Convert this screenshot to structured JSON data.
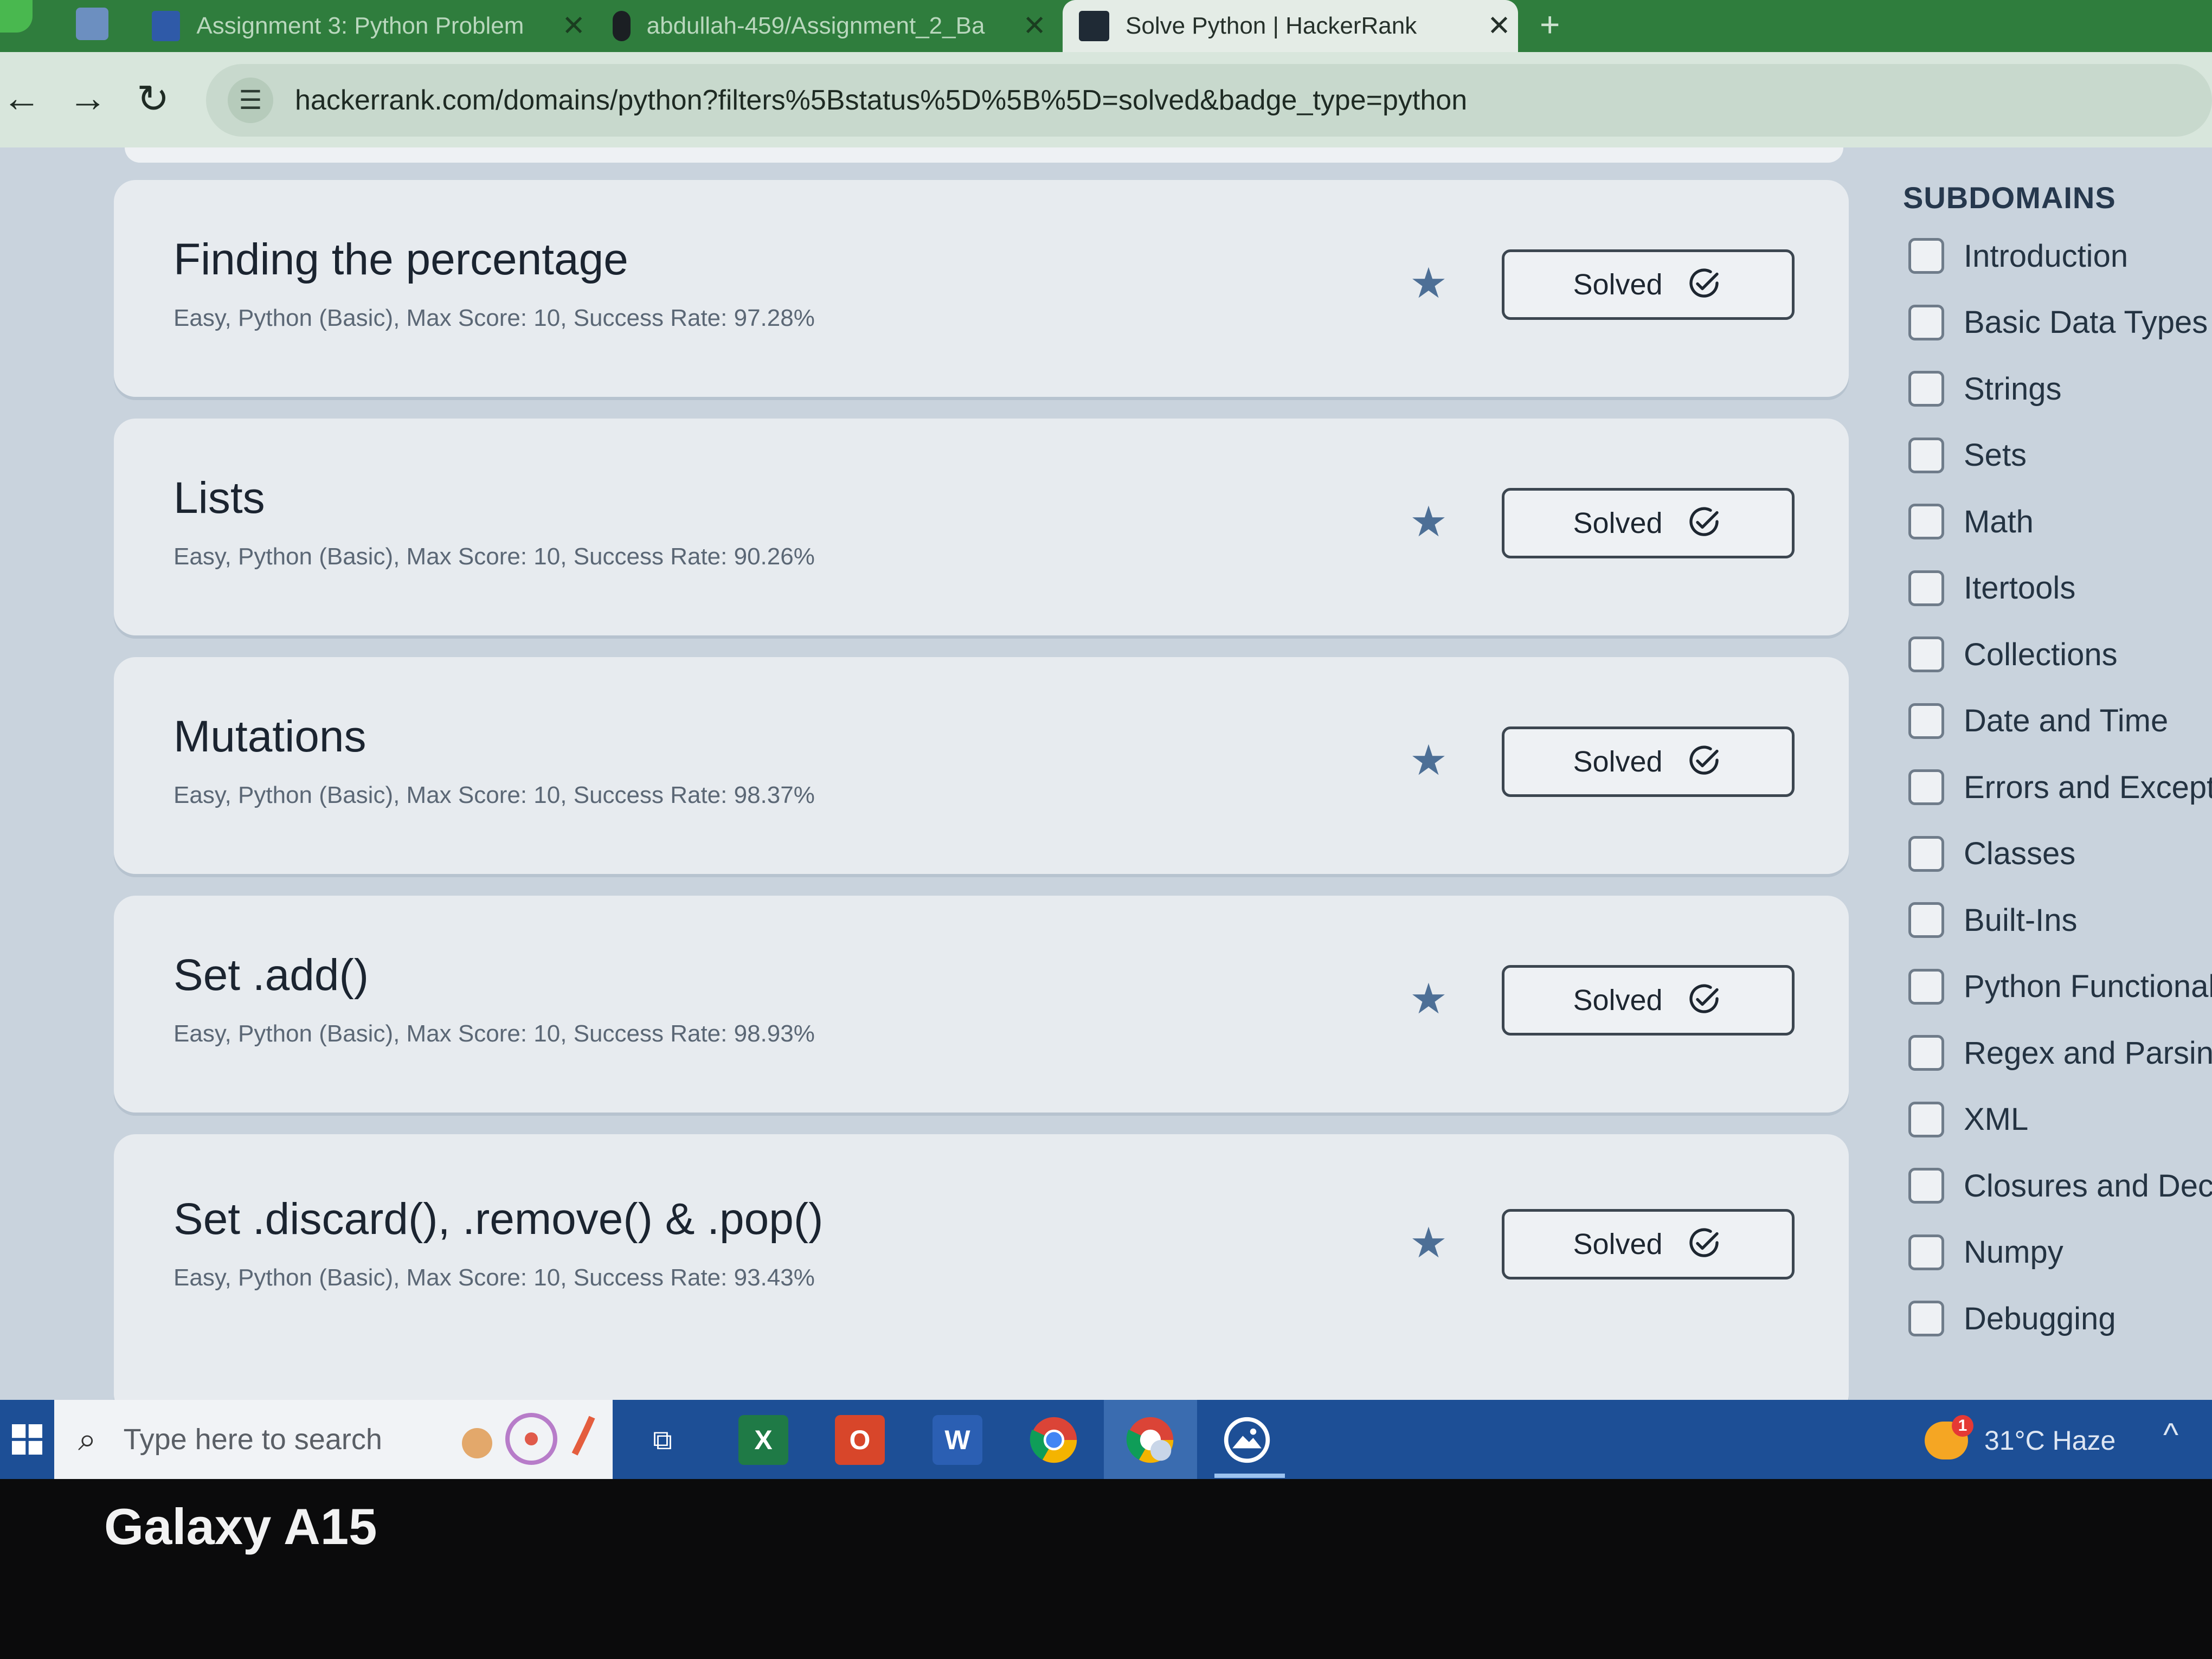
{
  "browser": {
    "tabs": [
      {
        "label": "Assignment 3: Python Problem",
        "active": false
      },
      {
        "label": "abdullah-459/Assignment_2_Ba",
        "active": false
      },
      {
        "label": "Solve Python | HackerRank",
        "active": true
      }
    ],
    "new_tab_label": "+",
    "url": "hackerrank.com/domains/python?filters%5Bstatus%5D%5B%5D=solved&badge_type=python"
  },
  "challenges": [
    {
      "title": "Finding the percentage",
      "meta": "Easy, Python (Basic), Max Score: 10, Success Rate: 97.28%",
      "status": "Solved"
    },
    {
      "title": "Lists",
      "meta": "Easy, Python (Basic), Max Score: 10, Success Rate: 90.26%",
      "status": "Solved"
    },
    {
      "title": "Mutations",
      "meta": "Easy, Python (Basic), Max Score: 10, Success Rate: 98.37%",
      "status": "Solved"
    },
    {
      "title": "Set .add()",
      "meta": "Easy, Python (Basic), Max Score: 10, Success Rate: 98.93%",
      "status": "Solved"
    },
    {
      "title": "Set .discard(), .remove() & .pop()",
      "meta": "Easy, Python (Basic), Max Score: 10, Success Rate: 93.43%",
      "status": "Solved"
    }
  ],
  "sidebar": {
    "title": "SUBDOMAINS",
    "items": [
      "Introduction",
      "Basic Data Types",
      "Strings",
      "Sets",
      "Math",
      "Itertools",
      "Collections",
      "Date and Time",
      "Errors and Excepti",
      "Classes",
      "Built-Ins",
      "Python Functional",
      "Regex and Parsing",
      "XML",
      "Closures and Deco",
      "Numpy",
      "Debugging"
    ]
  },
  "taskbar": {
    "search_placeholder": "Type here to search",
    "weather": "31°C  Haze",
    "weather_alert_count": "1",
    "apps": [
      "task-view",
      "excel",
      "office",
      "word",
      "chrome",
      "chrome-profile",
      "photos"
    ]
  },
  "device": {
    "watermark": "Galaxy A15"
  },
  "colors": {
    "accent": "#2f7d3d",
    "taskbar": "#1d4f96",
    "star": "#4d6f96"
  }
}
